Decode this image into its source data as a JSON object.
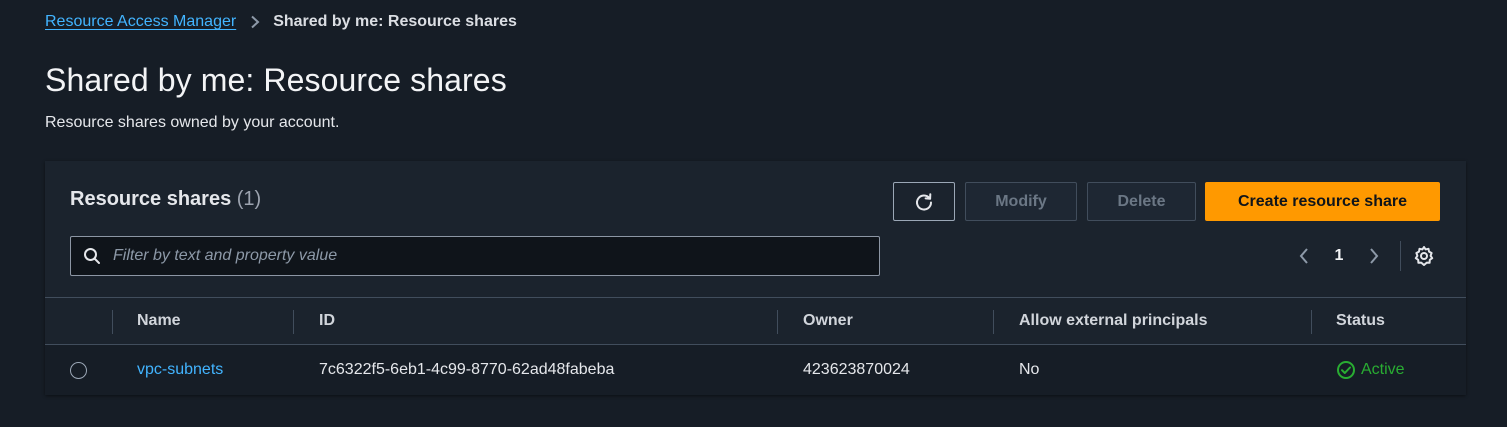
{
  "breadcrumb": {
    "parent": "Resource Access Manager",
    "current": "Shared by me: Resource shares"
  },
  "page": {
    "title": "Shared by me: Resource shares",
    "description": "Resource shares owned by your account."
  },
  "container": {
    "title": "Resource shares",
    "count": "(1)",
    "actions": {
      "refresh_icon": "refresh-icon",
      "modify": "Modify",
      "delete": "Delete",
      "create": "Create resource share"
    },
    "search": {
      "placeholder": "Filter by text and property value",
      "value": ""
    },
    "pagination": {
      "current_page": "1"
    }
  },
  "table": {
    "columns": [
      "Name",
      "ID",
      "Owner",
      "Allow external principals",
      "Status"
    ],
    "rows": [
      {
        "name": "vpc-subnets",
        "id": "7c6322f5-6eb1-4c99-8770-62ad48fabeba",
        "owner": "423623870024",
        "allow_external": "No",
        "status": "Active"
      }
    ]
  },
  "colors": {
    "background": "#161d26",
    "link": "#42b4ff",
    "primary_button": "#ff9900",
    "status_active": "#29ad32"
  }
}
